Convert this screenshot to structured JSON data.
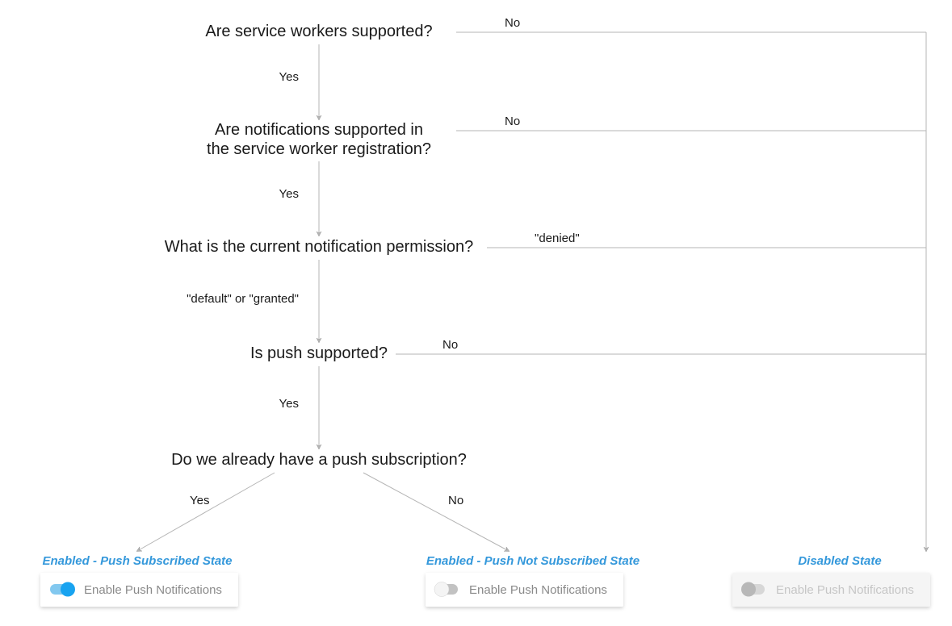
{
  "nodes": {
    "q_service_workers": "Are service workers supported?",
    "q_notifications_line1": "Are notifications supported in",
    "q_notifications_line2": "the service worker registration?",
    "q_permission": "What is the current notification permission?",
    "q_push": "Is push supported?",
    "q_subscription": "Do we already have a push subscription?"
  },
  "edges": {
    "no": "No",
    "yes": "Yes",
    "denied": "\"denied\"",
    "default_or_granted": "\"default\" or \"granted\"",
    "yes2": "Yes",
    "no2": "No",
    "yes3": "Yes",
    "yes4": "Yes",
    "sub_yes": "Yes",
    "sub_no": "No"
  },
  "states": {
    "subscribed": {
      "title": "Enabled - Push Subscribed State",
      "toggle_label": "Enable Push Notifications",
      "toggle_on": true,
      "disabled": false
    },
    "not_subscribed": {
      "title": "Enabled - Push Not Subscribed State",
      "toggle_label": "Enable Push Notifications",
      "toggle_on": false,
      "disabled": false
    },
    "disabled": {
      "title": "Disabled State",
      "toggle_label": "Enable Push Notifications",
      "toggle_on": false,
      "disabled": true
    }
  },
  "colors": {
    "accent": "#3498db",
    "toggle_on_track": "#82c8ef",
    "toggle_on_knob": "#18a3f0",
    "toggle_off_track": "#c2c2c2",
    "toggle_off_knob": "#f4f4f4",
    "toggle_disabled_track": "#d7d7d7",
    "toggle_disabled_knob": "#b8b8b8",
    "line": "#b5b5b5",
    "shadow": "rgba(0,0,0,0.15)"
  }
}
